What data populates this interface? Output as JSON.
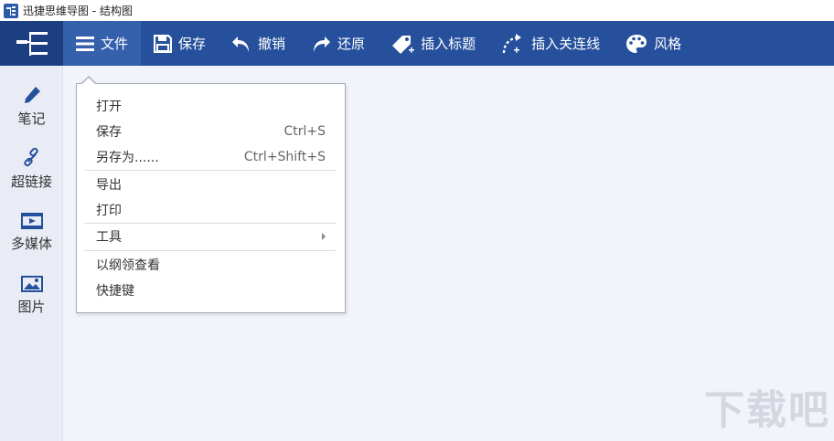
{
  "window": {
    "title": "迅捷思维导图 - 结构图"
  },
  "toolbar": {
    "buttons": [
      {
        "label": "文件",
        "icon": "menu-icon",
        "active": true
      },
      {
        "label": "保存",
        "icon": "save-icon"
      },
      {
        "label": "撤销",
        "icon": "undo-icon"
      },
      {
        "label": "还原",
        "icon": "redo-icon"
      },
      {
        "label": "插入标题",
        "icon": "tag-plus-icon"
      },
      {
        "label": "插入关连线",
        "icon": "connector-plus-icon"
      },
      {
        "label": "风格",
        "icon": "palette-icon"
      }
    ]
  },
  "sidebar": {
    "items": [
      {
        "label": "笔记",
        "icon": "pencil-icon"
      },
      {
        "label": "超链接",
        "icon": "link-icon"
      },
      {
        "label": "多媒体",
        "icon": "film-icon"
      },
      {
        "label": "图片",
        "icon": "image-icon"
      }
    ]
  },
  "file_menu": {
    "items": [
      {
        "label": "打开",
        "shortcut": ""
      },
      {
        "label": "保存",
        "shortcut": "Ctrl+S"
      },
      {
        "label": "另存为......",
        "shortcut": "Ctrl+Shift+S"
      },
      {
        "label": "导出",
        "shortcut": ""
      },
      {
        "label": "打印",
        "shortcut": ""
      },
      {
        "label": "工具",
        "shortcut": "",
        "submenu": true
      },
      {
        "label": "以纲领查看",
        "shortcut": ""
      },
      {
        "label": "快捷键",
        "shortcut": ""
      }
    ]
  },
  "watermark": {
    "text": "下载吧"
  },
  "colors": {
    "toolbar_bg": "#26509c",
    "logo_bg": "#1c3f82",
    "active_btn": "#3560ac",
    "canvas_bg": "#f2f4fb",
    "sidebar_bg": "#e9ecf4"
  }
}
